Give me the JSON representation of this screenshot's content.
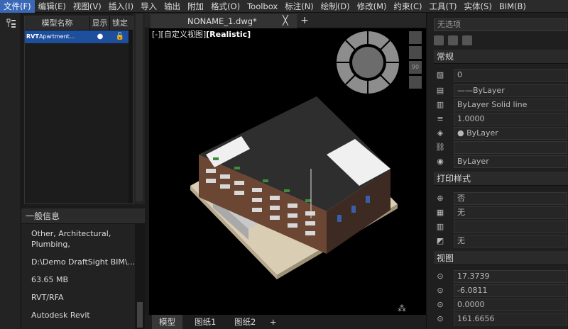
{
  "menu": [
    "文件(F)",
    "编辑(E)",
    "视图(V)",
    "插入(I)",
    "导入",
    "输出",
    "附加",
    "格式(O)",
    "Toolbox",
    "标注(N)",
    "绘制(D)",
    "修改(M)",
    "约束(C)",
    "工具(T)",
    "实体(S)",
    "BIM(B)"
  ],
  "model_panel": {
    "col_name": "模型名称",
    "col_show": "显示",
    "col_lock": "锁定",
    "row": {
      "ext": "RVT",
      "name": "Apartment..."
    }
  },
  "info": {
    "title": "一般信息",
    "lines": [
      "Other, Architectural,",
      "Plumbing,",
      "D:\\Demo DraftSight BIM\\...",
      "63.65 MB",
      "RVT/RFA",
      "Autodesk Revit"
    ]
  },
  "doc_tab": {
    "name": "NONAME_1.dwg*",
    "close": "╳",
    "add": "+"
  },
  "viewport": {
    "prefix": "[-][自定义视图]",
    "style": "[Realistic]",
    "zoom_btn": "90"
  },
  "bottom_tabs": [
    "模型",
    "图纸1",
    "图纸2",
    "+"
  ],
  "props": {
    "selection": "无选项",
    "sections": {
      "general": "常规",
      "print": "打印样式",
      "view": "视图"
    },
    "general_rows": [
      "0",
      "——ByLayer",
      "ByLayer     Solid line",
      "1.0000",
      "● ByLayer",
      "",
      "ByLayer"
    ],
    "print_rows": [
      "否",
      "无",
      "",
      "无"
    ],
    "view_rows": [
      "17.3739",
      "-6.0811",
      "0.0000",
      "161.6656"
    ]
  },
  "colors": {
    "accent": "#3a68b7",
    "selection_row": "#1e4f9c",
    "background": "#1b1b1b"
  }
}
